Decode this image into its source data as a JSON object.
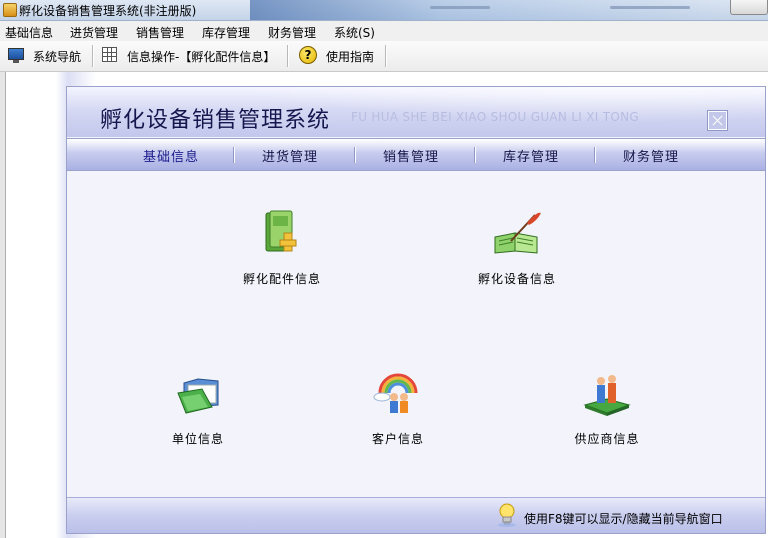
{
  "window": {
    "title": "孵化设备销售管理系统(非注册版)"
  },
  "menubar": {
    "items": [
      "基础信息",
      "进货管理",
      "销售管理",
      "库存管理",
      "财务管理",
      "系统(S)"
    ]
  },
  "toolbar": {
    "nav_label": "系统导航",
    "info_op_label": "信息操作-【孵化配件信息】",
    "guide_label": "使用指南"
  },
  "nav": {
    "title_cn": "孵化设备销售管理系统",
    "title_en": "FU HUA SHE BEI XIAO SHOU GUAN LI XI TONG",
    "tabs": [
      "基础信息",
      "进货管理",
      "销售管理",
      "库存管理",
      "财务管理"
    ],
    "active_tab": "基础信息",
    "items": [
      {
        "label": "孵化配件信息",
        "icon": "book-icon"
      },
      {
        "label": "孵化设备信息",
        "icon": "open-book-quill-icon"
      },
      {
        "label": "单位信息",
        "icon": "folder-icon"
      },
      {
        "label": "客户信息",
        "icon": "people-rainbow-icon"
      },
      {
        "label": "供应商信息",
        "icon": "people-platform-icon"
      }
    ],
    "footer_hint": "使用F8键可以显示/隐藏当前导航窗口"
  },
  "colors": {
    "panel_bg": "#f2f3fb",
    "header_blue": "#c2c7ec",
    "title_text": "#16164e"
  }
}
